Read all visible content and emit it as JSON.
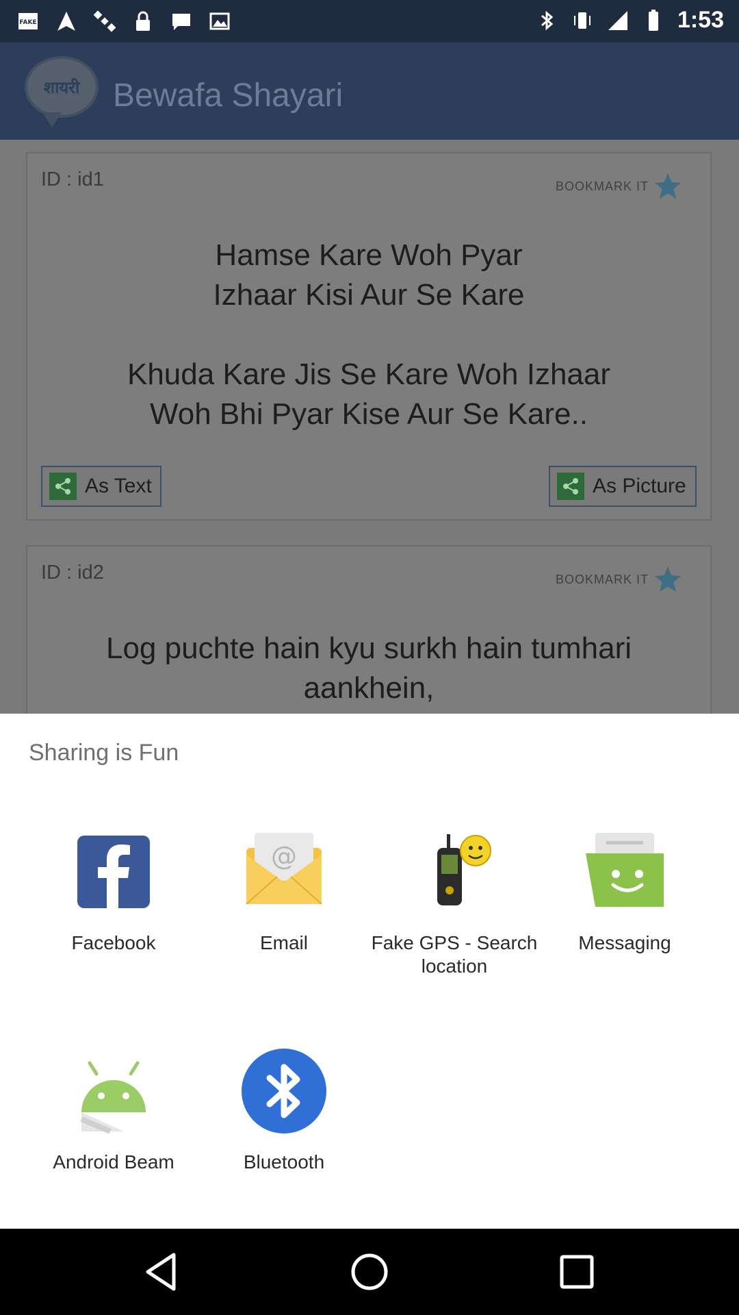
{
  "status_bar": {
    "time": "1:53",
    "left_icons": [
      "fake-icon",
      "gps-icon",
      "satellite-icon",
      "lock-icon",
      "chat-icon",
      "image-icon"
    ],
    "right_icons": [
      "bluetooth-icon",
      "vibrate-icon",
      "signal-icon",
      "battery-icon"
    ]
  },
  "app": {
    "logo_text": "शायरी",
    "title": "Bewafa Shayari",
    "cards": [
      {
        "id": "ID : id1",
        "bookmark_label": "BOOKMARK IT",
        "lines": [
          "Hamse Kare Woh Pyar",
          "Izhaar Kisi Aur Se Kare",
          "",
          "Khuda Kare Jis Se Kare Woh Izhaar",
          "Woh Bhi Pyar Kise Aur Se Kare.."
        ],
        "as_text": "As Text",
        "as_picture": "As Picture"
      },
      {
        "id": "ID : id2",
        "bookmark_label": "BOOKMARK IT",
        "lines": [
          "Log puchte hain kyu surkh hain tumhari",
          "aankhein,"
        ]
      }
    ]
  },
  "share_sheet": {
    "title": "Sharing is Fun",
    "apps": [
      {
        "label": "Facebook",
        "icon": "facebook-icon"
      },
      {
        "label": "Email",
        "icon": "email-icon"
      },
      {
        "label": "Fake GPS - Search location",
        "icon": "fake-gps-icon"
      },
      {
        "label": "Messaging",
        "icon": "messaging-icon"
      },
      {
        "label": "Android Beam",
        "icon": "android-beam-icon"
      },
      {
        "label": "Bluetooth",
        "icon": "bluetooth-icon"
      }
    ]
  },
  "colors": {
    "status_bar": "#1f2c3f",
    "app_bar": "#2c3e5a",
    "facebook": "#3b5998",
    "bluetooth": "#2f6fd6",
    "messaging": "#8bc34a",
    "android": "#9ccc65"
  },
  "nav_bar": {
    "buttons": [
      "back-icon",
      "home-icon",
      "recents-icon"
    ]
  }
}
